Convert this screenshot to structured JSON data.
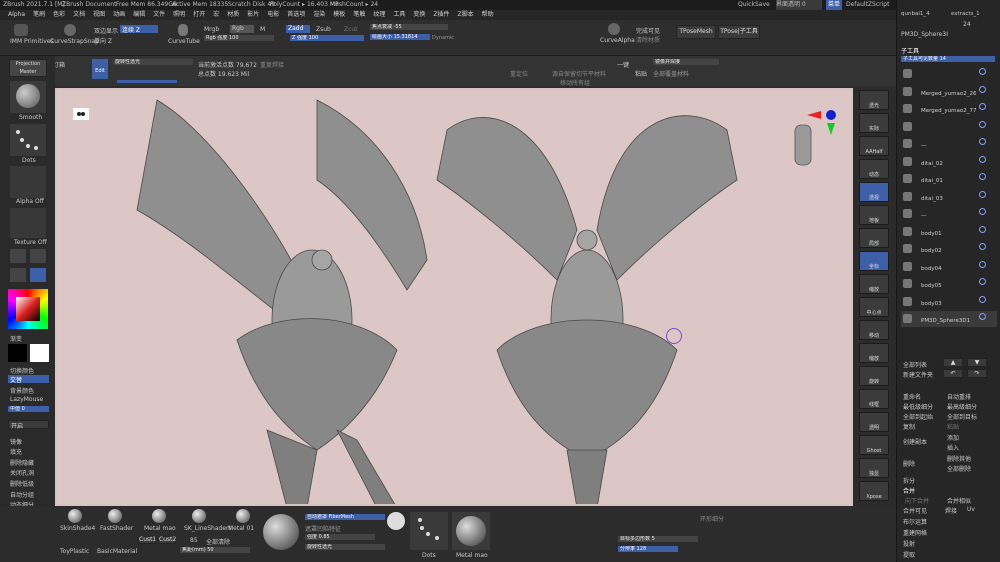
{
  "titlebar": {
    "app": "ZBrush 2021.7.1 [M]",
    "doc": "ZBrush Document",
    "free_mem": "Free Mem 86.349GB",
    "active_mem": "Active Mem 18335",
    "scratch": "Scratch Disk 49",
    "poly": "PolyCount ▸ 16.403 MP",
    "mesh": "MeshCount ▸ 24",
    "quicksave": "QuickSave",
    "transparency": "界面透明 0",
    "menus_btn": "菜单",
    "script": "DefaultZScript"
  },
  "menubar": [
    "Alpha",
    "笔刷",
    "色彩",
    "文档",
    "视图",
    "动画",
    "编辑",
    "文件",
    "照明",
    "打开",
    "宏",
    "材质",
    "影片",
    "电影",
    "首选项",
    "渲染",
    "模板",
    "笔触",
    "纹理",
    "工具",
    "变换",
    "Z插件",
    "Z脚本",
    "帮助"
  ],
  "toolbar": {
    "imm": "IMM Primitives",
    "curvestrap": "CurveStrapSnap",
    "double_display": "双边显示",
    "single_z": "单向 Z",
    "continue_z": "连续 Z",
    "curvetube": "CurveTube",
    "mrgb": "Mrgb",
    "rgb": "Rgb",
    "m": "M",
    "rgb_strength": "Rgb 强度 100",
    "zadd": "Zadd",
    "zsub": "Zsub",
    "zcut": "Zcut",
    "z_strength": "Z 强度 100",
    "focal": "焦点衰减 -55",
    "draw_size": "绘画大小 15.31814",
    "dynamic": "Dynamic",
    "curvealpha": "CurveAlpha",
    "complete": "完成可见",
    "tposemesh": "TPoseMesh",
    "tpose_sub": "TPose|子工具",
    "clean_material": "清除材质"
  },
  "subbar": {
    "projection_master": "Projection Master",
    "lightbox": "灯箱",
    "edit": "Edit",
    "rotate": "旋转性透光",
    "active_points": "当前激活点数 79,672",
    "total_points": "总点数 19.623 Mil",
    "weld": "重复焊接",
    "relocate": "重定位",
    "hold_material": "源自保留切节平材料",
    "move_group": "移动所有组",
    "one_key": "一键",
    "mirror_weld": "镜像并焊接",
    "quick": "粘贴",
    "all_material": "全部覆盖材料"
  },
  "left": {
    "smooth": "Smooth",
    "dots": "Dots",
    "alpha_off": "Alpha Off",
    "texture_off": "Texture Off",
    "gradient": "渐变",
    "switch_color": "切换颜色",
    "alternate": "交替",
    "bg_color": "背景颜色",
    "lazymouse": "LazyMouse",
    "lazy_value": "中值 0",
    "open": "开启",
    "mirror": "镜像",
    "fill": "填充",
    "hide": "删除隐藏",
    "close_hole": "关闭孔洞",
    "del_lower": "删除低级",
    "auto_group": "自动分组",
    "dynamic_sub": "动态细分",
    "move": "移动",
    "scale": "缩放",
    "rotate": "旋转"
  },
  "canvas_icon": "footprint-icon",
  "right_tools": [
    "透光",
    "实际",
    "AAHalf",
    "动态",
    "透视",
    "地板",
    "局部",
    "坐标",
    "缩放",
    "中心点",
    "移动",
    "缩放",
    "旋转",
    "线框",
    "透明",
    "Ghost",
    "独显",
    "Xpose"
  ],
  "rightpanel": {
    "top1": "qunbai1_4",
    "top2": "extracts_1",
    "num": "24",
    "sphere": "PM3D_Sphere3I",
    "subtool": "子工具",
    "visible": "子工具可见数量 14",
    "items": [
      "",
      "Merged_yumao2_26",
      "Merged_yumao2_77",
      "",
      "—",
      "ditai_02",
      "ditai_01",
      "ditai_03",
      "—",
      "body01",
      "body02",
      "body04",
      "body05",
      "body03",
      "PM3D_Sphere3D1"
    ],
    "list_all": "全部列表",
    "new_folder": "新建文件夹",
    "rename": "重命名",
    "auto_reorder": "自动重排",
    "lowest_sub": "最低级细分",
    "highest_sub": "最高级细分",
    "all_low": "全部到起始",
    "all_high": "全部到目标",
    "copy": "复制",
    "paste": "粘贴",
    "create_copy": "创建副本",
    "add": "添加",
    "insert": "插入",
    "delete": "删除",
    "del_other": "删除其他",
    "del_all": "全部删除",
    "split": "拆分",
    "merge": "合并",
    "merge_down": "向下合并",
    "merge_similar": "合并相似",
    "merge_visible": "合并可见",
    "weld": "焊接",
    "uv": "Uv",
    "boolean": "布尔运算",
    "remesh": "重建网格",
    "project": "投射",
    "extract": "提取"
  },
  "bottom": {
    "materials": [
      "SkinShade4",
      "FastShader",
      "Metal mao",
      "SK_LineShaders",
      "Metal 01"
    ],
    "toyplastic": "ToyPlastic",
    "basic": "BasicMaterial",
    "cust1": "Cust1",
    "cust2": "Cust2",
    "value85": "85",
    "all_clear": "全部清除",
    "focal_mm": "焦距(mm) 50",
    "fibermesh": "自动遮罩 FiberMesh",
    "mask_cavity": "遮罩凹陷特征",
    "strength": "强度 0.85",
    "rotate2": "旋转性透光",
    "dots": "Dots",
    "metal": "Metal mao",
    "target_poly": "目标多边形数 5",
    "resolution": "分辨率 128",
    "rings": "环形细分"
  },
  "colors": {
    "accent": "#3d5fa8",
    "canvas": "#ddc6c6"
  }
}
